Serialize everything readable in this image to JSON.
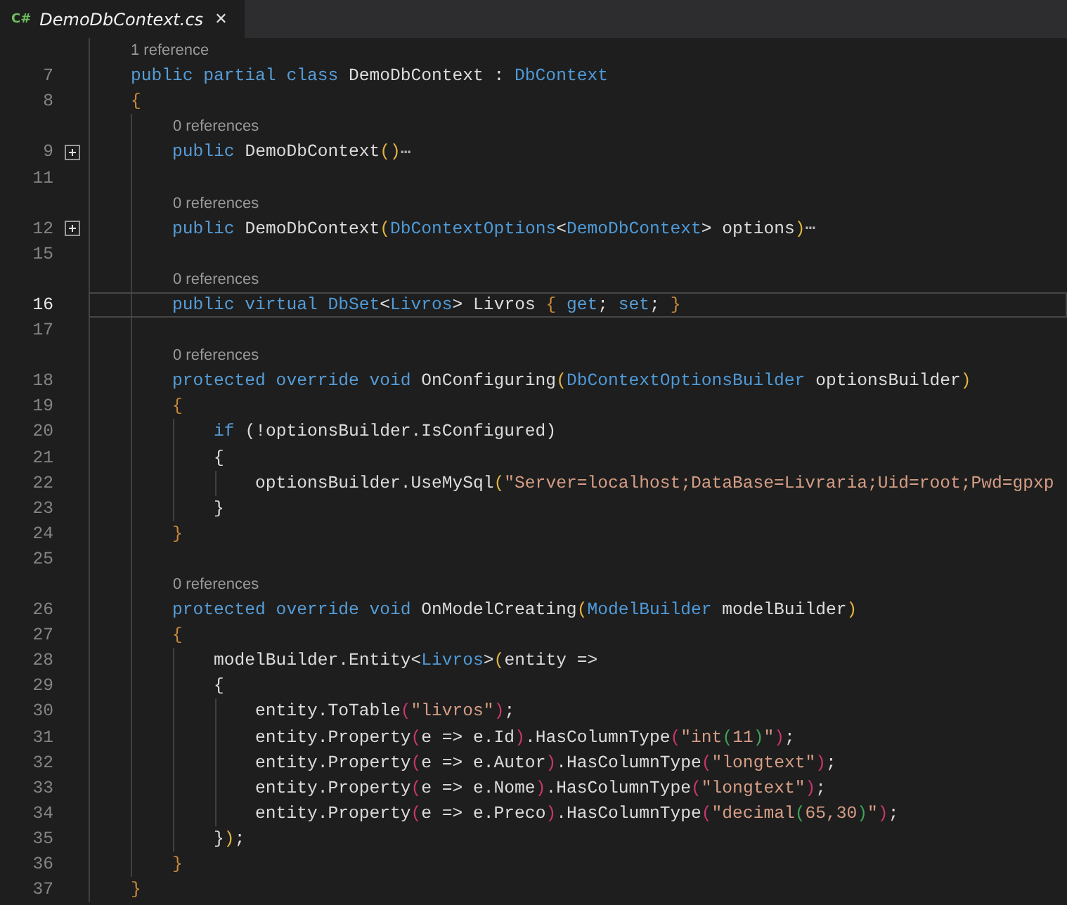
{
  "tab": {
    "icon_label": "C#",
    "title": "DemoDbContext.cs",
    "close": "✕"
  },
  "rows": [
    {
      "kind": "codelens",
      "text": "1 reference"
    },
    {
      "kind": "code",
      "number": "7",
      "tokens": [
        {
          "kind": "kw",
          "text": "public partial class "
        },
        {
          "kind": "plain",
          "text": "DemoDbContext : "
        },
        {
          "kind": "type",
          "text": "DbContext"
        }
      ]
    },
    {
      "kind": "code",
      "number": "8",
      "tokens": [
        {
          "kind": "brace",
          "text": "{"
        }
      ]
    },
    {
      "kind": "codelens",
      "text": "0 references"
    },
    {
      "kind": "code",
      "number": "9",
      "collapsed": true,
      "tokens": [
        {
          "kind": "kw",
          "text": "    public "
        },
        {
          "kind": "plain",
          "text": "DemoDbContext"
        },
        {
          "kind": "paren",
          "text": "()"
        },
        {
          "kind": "ellipsis",
          "text": "⋯"
        }
      ]
    },
    {
      "kind": "code",
      "number": "11",
      "tokens": []
    },
    {
      "kind": "codelens",
      "text": "0 references"
    },
    {
      "kind": "code",
      "number": "12",
      "collapsed": true,
      "tokens": [
        {
          "kind": "kw",
          "text": "    public "
        },
        {
          "kind": "plain",
          "text": "DemoDbContext"
        },
        {
          "kind": "paren",
          "text": "("
        },
        {
          "kind": "type",
          "text": "DbContextOptions"
        },
        {
          "kind": "plain",
          "text": "<"
        },
        {
          "kind": "type",
          "text": "DemoDbContext"
        },
        {
          "kind": "plain",
          "text": "> options"
        },
        {
          "kind": "paren",
          "text": ")"
        },
        {
          "kind": "ellipsis",
          "text": "⋯"
        }
      ]
    },
    {
      "kind": "code",
      "number": "15",
      "tokens": []
    },
    {
      "kind": "codelens",
      "text": "0 references"
    },
    {
      "kind": "code",
      "number": "16",
      "current": true,
      "tokens": [
        {
          "kind": "kw",
          "text": "    public virtual "
        },
        {
          "kind": "type",
          "text": "DbSet"
        },
        {
          "kind": "plain",
          "text": "<"
        },
        {
          "kind": "type",
          "text": "Livros"
        },
        {
          "kind": "plain",
          "text": "> Livros "
        },
        {
          "kind": "brace",
          "text": "{"
        },
        {
          "kind": "kw",
          "text": " get"
        },
        {
          "kind": "plain",
          "text": "; "
        },
        {
          "kind": "kw",
          "text": "set"
        },
        {
          "kind": "plain",
          "text": "; "
        },
        {
          "kind": "brace",
          "text": "}"
        }
      ]
    },
    {
      "kind": "code",
      "number": "17",
      "tokens": []
    },
    {
      "kind": "codelens",
      "text": "0 references"
    },
    {
      "kind": "code",
      "number": "18",
      "tokens": [
        {
          "kind": "kw",
          "text": "    protected override void "
        },
        {
          "kind": "plain",
          "text": "OnConfiguring"
        },
        {
          "kind": "paren",
          "text": "("
        },
        {
          "kind": "type",
          "text": "DbContextOptionsBuilder"
        },
        {
          "kind": "plain",
          "text": " optionsBuilder"
        },
        {
          "kind": "paren",
          "text": ")"
        }
      ]
    },
    {
      "kind": "code",
      "number": "19",
      "tokens": [
        {
          "kind": "brace",
          "text": "    {"
        }
      ]
    },
    {
      "kind": "code",
      "number": "20",
      "tokens": [
        {
          "kind": "kw",
          "text": "        if "
        },
        {
          "kind": "plain",
          "text": "(!optionsBuilder.IsConfigured)"
        }
      ]
    },
    {
      "kind": "code",
      "number": "21",
      "tokens": [
        {
          "kind": "plain",
          "text": "        {"
        }
      ]
    },
    {
      "kind": "code",
      "number": "22",
      "tokens": [
        {
          "kind": "plain",
          "text": "            optionsBuilder.UseMySql"
        },
        {
          "kind": "paren",
          "text": "("
        },
        {
          "kind": "str",
          "text": "\"Server=localhost;DataBase=Livraria;Uid=root;Pwd=gpxp"
        }
      ]
    },
    {
      "kind": "code",
      "number": "23",
      "tokens": [
        {
          "kind": "plain",
          "text": "        }"
        }
      ]
    },
    {
      "kind": "code",
      "number": "24",
      "tokens": [
        {
          "kind": "brace",
          "text": "    }"
        }
      ]
    },
    {
      "kind": "code",
      "number": "25",
      "tokens": []
    },
    {
      "kind": "codelens",
      "text": "0 references"
    },
    {
      "kind": "code",
      "number": "26",
      "tokens": [
        {
          "kind": "kw",
          "text": "    protected override void "
        },
        {
          "kind": "plain",
          "text": "OnModelCreating"
        },
        {
          "kind": "paren",
          "text": "("
        },
        {
          "kind": "type",
          "text": "ModelBuilder"
        },
        {
          "kind": "plain",
          "text": " modelBuilder"
        },
        {
          "kind": "paren",
          "text": ")"
        }
      ]
    },
    {
      "kind": "code",
      "number": "27",
      "tokens": [
        {
          "kind": "brace",
          "text": "    {"
        }
      ]
    },
    {
      "kind": "code",
      "number": "28",
      "tokens": [
        {
          "kind": "plain",
          "text": "        modelBuilder.Entity<"
        },
        {
          "kind": "type",
          "text": "Livros"
        },
        {
          "kind": "plain",
          "text": ">"
        },
        {
          "kind": "paren",
          "text": "("
        },
        {
          "kind": "plain",
          "text": "entity =>"
        }
      ]
    },
    {
      "kind": "code",
      "number": "29",
      "tokens": [
        {
          "kind": "plain",
          "text": "        {"
        }
      ]
    },
    {
      "kind": "code",
      "number": "30",
      "tokens": [
        {
          "kind": "plain",
          "text": "            entity.ToTable"
        },
        {
          "kind": "paren2",
          "text": "("
        },
        {
          "kind": "str",
          "text": "\"livros\""
        },
        {
          "kind": "paren2",
          "text": ")"
        },
        {
          "kind": "plain",
          "text": ";"
        }
      ]
    },
    {
      "kind": "code",
      "number": "31",
      "tokens": [
        {
          "kind": "plain",
          "text": "            entity.Property"
        },
        {
          "kind": "paren2",
          "text": "("
        },
        {
          "kind": "plain",
          "text": "e => e.Id"
        },
        {
          "kind": "paren2",
          "text": ")"
        },
        {
          "kind": "plain",
          "text": ".HasColumnType"
        },
        {
          "kind": "paren2",
          "text": "("
        },
        {
          "kind": "str",
          "text": "\"int"
        },
        {
          "kind": "paren3",
          "text": "("
        },
        {
          "kind": "str",
          "text": "11"
        },
        {
          "kind": "paren3",
          "text": ")"
        },
        {
          "kind": "str",
          "text": "\""
        },
        {
          "kind": "paren2",
          "text": ")"
        },
        {
          "kind": "plain",
          "text": ";"
        }
      ]
    },
    {
      "kind": "code",
      "number": "32",
      "tokens": [
        {
          "kind": "plain",
          "text": "            entity.Property"
        },
        {
          "kind": "paren2",
          "text": "("
        },
        {
          "kind": "plain",
          "text": "e => e.Autor"
        },
        {
          "kind": "paren2",
          "text": ")"
        },
        {
          "kind": "plain",
          "text": ".HasColumnType"
        },
        {
          "kind": "paren2",
          "text": "("
        },
        {
          "kind": "str",
          "text": "\"longtext\""
        },
        {
          "kind": "paren2",
          "text": ")"
        },
        {
          "kind": "plain",
          "text": ";"
        }
      ]
    },
    {
      "kind": "code",
      "number": "33",
      "tokens": [
        {
          "kind": "plain",
          "text": "            entity.Property"
        },
        {
          "kind": "paren2",
          "text": "("
        },
        {
          "kind": "plain",
          "text": "e => e.Nome"
        },
        {
          "kind": "paren2",
          "text": ")"
        },
        {
          "kind": "plain",
          "text": ".HasColumnType"
        },
        {
          "kind": "paren2",
          "text": "("
        },
        {
          "kind": "str",
          "text": "\"longtext\""
        },
        {
          "kind": "paren2",
          "text": ")"
        },
        {
          "kind": "plain",
          "text": ";"
        }
      ]
    },
    {
      "kind": "code",
      "number": "34",
      "tokens": [
        {
          "kind": "plain",
          "text": "            entity.Property"
        },
        {
          "kind": "paren2",
          "text": "("
        },
        {
          "kind": "plain",
          "text": "e => e.Preco"
        },
        {
          "kind": "paren2",
          "text": ")"
        },
        {
          "kind": "plain",
          "text": ".HasColumnType"
        },
        {
          "kind": "paren2",
          "text": "("
        },
        {
          "kind": "str",
          "text": "\"decimal"
        },
        {
          "kind": "paren3",
          "text": "("
        },
        {
          "kind": "str",
          "text": "65,30"
        },
        {
          "kind": "paren3",
          "text": ")"
        },
        {
          "kind": "str",
          "text": "\""
        },
        {
          "kind": "paren2",
          "text": ")"
        },
        {
          "kind": "plain",
          "text": ";"
        }
      ]
    },
    {
      "kind": "code",
      "number": "35",
      "tokens": [
        {
          "kind": "plain",
          "text": "        }"
        },
        {
          "kind": "paren",
          "text": ")"
        },
        {
          "kind": "plain",
          "text": ";"
        }
      ]
    },
    {
      "kind": "code",
      "number": "36",
      "tokens": [
        {
          "kind": "brace",
          "text": "    }"
        }
      ]
    },
    {
      "kind": "code",
      "number": "37",
      "tokens": [
        {
          "kind": "brace",
          "text": "}"
        }
      ]
    }
  ]
}
